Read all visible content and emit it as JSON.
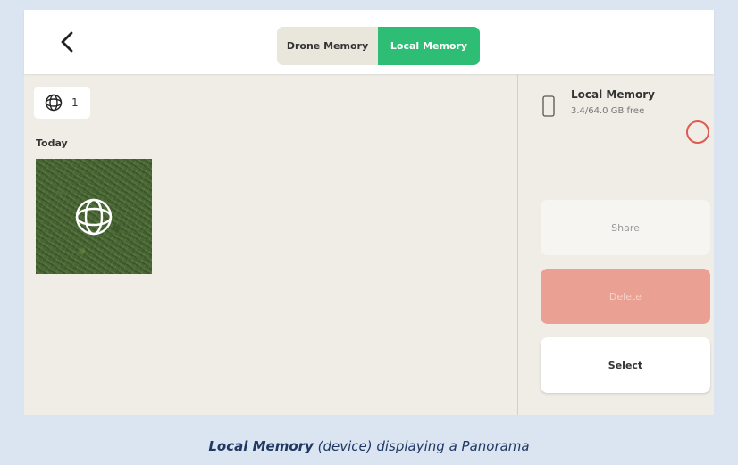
{
  "header": {
    "back_icon": "chevron-left-icon",
    "tabs": [
      {
        "label": "Drone Memory",
        "active": false
      },
      {
        "label": "Local Memory",
        "active": true
      }
    ]
  },
  "gallery": {
    "count_icon": "panorama-globe-icon",
    "count": "1",
    "sections": [
      {
        "label": "Today",
        "items": [
          {
            "type": "panorama",
            "icon": "panorama-globe-icon"
          }
        ]
      }
    ]
  },
  "side_panel": {
    "storage": {
      "icon": "phone-icon",
      "name": "Local Memory",
      "free": "3.4/64.0 GB free"
    },
    "actions": {
      "share": "Share",
      "delete": "Delete",
      "select": "Select"
    }
  },
  "caption": {
    "bold": "Local Memory",
    "rest": " (device) displaying a Panorama"
  },
  "colors": {
    "accent_green": "#2dbd74",
    "delete_red": "#eaa093",
    "circle_red": "#e05a52",
    "caption_blue": "#1f3864"
  }
}
